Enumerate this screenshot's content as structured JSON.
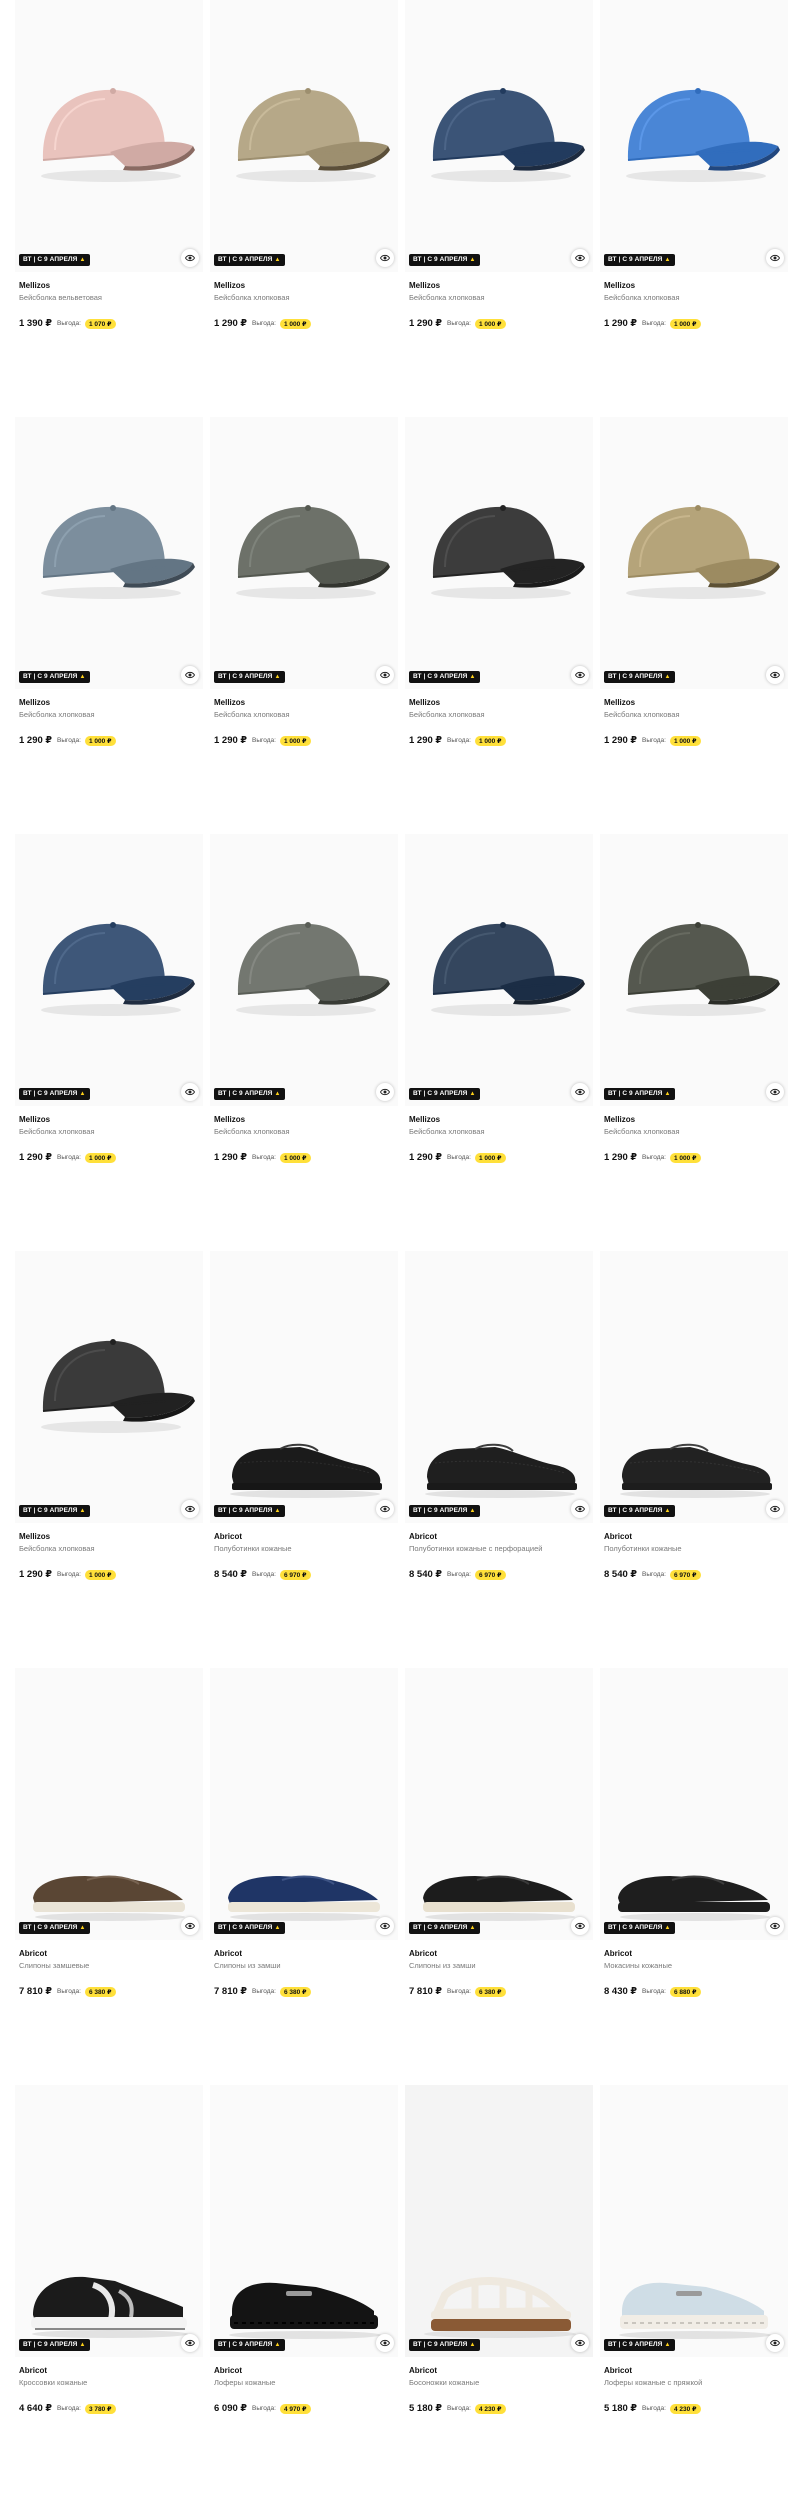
{
  "badge_text": "ВТ | С 9 АПРЕЛЯ",
  "save_label": "Выгода:",
  "colors": {
    "badge_bg": "#111111",
    "bell": "#ffd21a",
    "save_bg": "#ffe03a"
  },
  "products": [
    {
      "brand": "Mellizos",
      "title": "Бейсболка вельветовая",
      "price": "1 390 ₽",
      "save": "1 070 ₽",
      "kind": "cap",
      "color": "#e9c3bd",
      "brim": "#8a6a62"
    },
    {
      "brand": "Mellizos",
      "title": "Бейсболка хлопковая",
      "price": "1 290 ₽",
      "save": "1 000 ₽",
      "kind": "cap",
      "color": "#b6a888",
      "brim": "#5b4f39"
    },
    {
      "brand": "Mellizos",
      "title": "Бейсболка хлопковая",
      "price": "1 290 ₽",
      "save": "1 000 ₽",
      "kind": "cap",
      "color": "#3b5477",
      "brim": "#1d2b40"
    },
    {
      "brand": "Mellizos",
      "title": "Бейсболка хлопковая",
      "price": "1 290 ₽",
      "save": "1 000 ₽",
      "kind": "cap",
      "color": "#4a86d6",
      "brim": "#21477f"
    },
    {
      "brand": "Mellizos",
      "title": "Бейсболка хлопковая",
      "price": "1 290 ₽",
      "save": "1 000 ₽",
      "kind": "cap",
      "color": "#7c8e9d",
      "brim": "#3f4b56"
    },
    {
      "brand": "Mellizos",
      "title": "Бейсболка хлопковая",
      "price": "1 290 ₽",
      "save": "1 000 ₽",
      "kind": "cap",
      "color": "#6d7169",
      "brim": "#33352f"
    },
    {
      "brand": "Mellizos",
      "title": "Бейсболка хлопковая",
      "price": "1 290 ₽",
      "save": "1 000 ₽",
      "kind": "cap",
      "color": "#3c3c3c",
      "brim": "#1b1b1b"
    },
    {
      "brand": "Mellizos",
      "title": "Бейсболка хлопковая",
      "price": "1 290 ₽",
      "save": "1 000 ₽",
      "kind": "cap",
      "color": "#b5a47a",
      "brim": "#5d5134"
    },
    {
      "brand": "Mellizos",
      "title": "Бейсболка хлопковая",
      "price": "1 290 ₽",
      "save": "1 000 ₽",
      "kind": "cap",
      "color": "#3e5779",
      "brim": "#1f2c40"
    },
    {
      "brand": "Mellizos",
      "title": "Бейсболка хлопковая",
      "price": "1 290 ₽",
      "save": "1 000 ₽",
      "kind": "cap",
      "color": "#737770",
      "brim": "#383b35"
    },
    {
      "brand": "Mellizos",
      "title": "Бейсболка хлопковая",
      "price": "1 290 ₽",
      "save": "1 000 ₽",
      "kind": "cap",
      "color": "#34465e",
      "brim": "#19222e"
    },
    {
      "brand": "Mellizos",
      "title": "Бейсболка хлопковая",
      "price": "1 290 ₽",
      "save": "1 000 ₽",
      "kind": "cap",
      "color": "#55584f",
      "brim": "#2a2c27"
    },
    {
      "brand": "Mellizos",
      "title": "Бейсболка хлопковая",
      "price": "1 290 ₽",
      "save": "1 000 ₽",
      "kind": "cap",
      "color": "#3a3a3a",
      "brim": "#171717"
    },
    {
      "brand": "Abricot",
      "title": "Полуботинки кожаные",
      "price": "8 540 ₽",
      "save": "6 970 ₽",
      "kind": "oxford",
      "color": "#1b1b1b",
      "sole": "#1b1b1b"
    },
    {
      "brand": "Abricot",
      "title": "Полуботинки кожаные с перфорацией",
      "price": "8 540 ₽",
      "save": "6 970 ₽",
      "kind": "oxford",
      "color": "#1f1f1f",
      "sole": "#1f1f1f"
    },
    {
      "brand": "Abricot",
      "title": "Полуботинки кожаные",
      "price": "8 540 ₽",
      "save": "6 970 ₽",
      "kind": "oxford",
      "color": "#222222",
      "sole": "#222222"
    },
    {
      "brand": "Abricot",
      "title": "Слипоны замшевые",
      "price": "7 810 ₽",
      "save": "6 380 ₽",
      "kind": "loafer",
      "color": "#5a4634",
      "sole": "#e9e3d6"
    },
    {
      "brand": "Abricot",
      "title": "Слипоны из замши",
      "price": "7 810 ₽",
      "save": "6 380 ₽",
      "kind": "loafer",
      "color": "#1f3566",
      "sole": "#ece6d8"
    },
    {
      "brand": "Abricot",
      "title": "Слипоны из замши",
      "price": "7 810 ₽",
      "save": "6 380 ₽",
      "kind": "loafer",
      "color": "#1c1c1c",
      "sole": "#e8e0cf"
    },
    {
      "brand": "Abricot",
      "title": "Мокасины кожаные",
      "price": "8 430 ₽",
      "save": "6 880 ₽",
      "kind": "loafer",
      "color": "#1e1e1e",
      "sole": "#1e1e1e"
    },
    {
      "brand": "Abricot",
      "title": "Кроссовки кожаные",
      "price": "4 640 ₽",
      "save": "3 780 ₽",
      "kind": "sneaker",
      "color": "#1b1b1b",
      "sole": "#f3f3f3"
    },
    {
      "brand": "Abricot",
      "title": "Лоферы кожаные",
      "price": "6 090 ₽",
      "save": "4 970 ₽",
      "kind": "chunky",
      "color": "#141414",
      "sole": "#141414"
    },
    {
      "brand": "Abricot",
      "title": "Босоножки кожаные",
      "price": "5 180 ₽",
      "save": "4 230 ₽",
      "kind": "sandal",
      "color": "#efe9df",
      "sole": "#8a5a35"
    },
    {
      "brand": "Abricot",
      "title": "Лоферы кожаные с пряжкой",
      "price": "5 180 ₽",
      "save": "4 230 ₽",
      "kind": "chunky",
      "color": "#cfdde6",
      "sole": "#f1ede6"
    }
  ]
}
